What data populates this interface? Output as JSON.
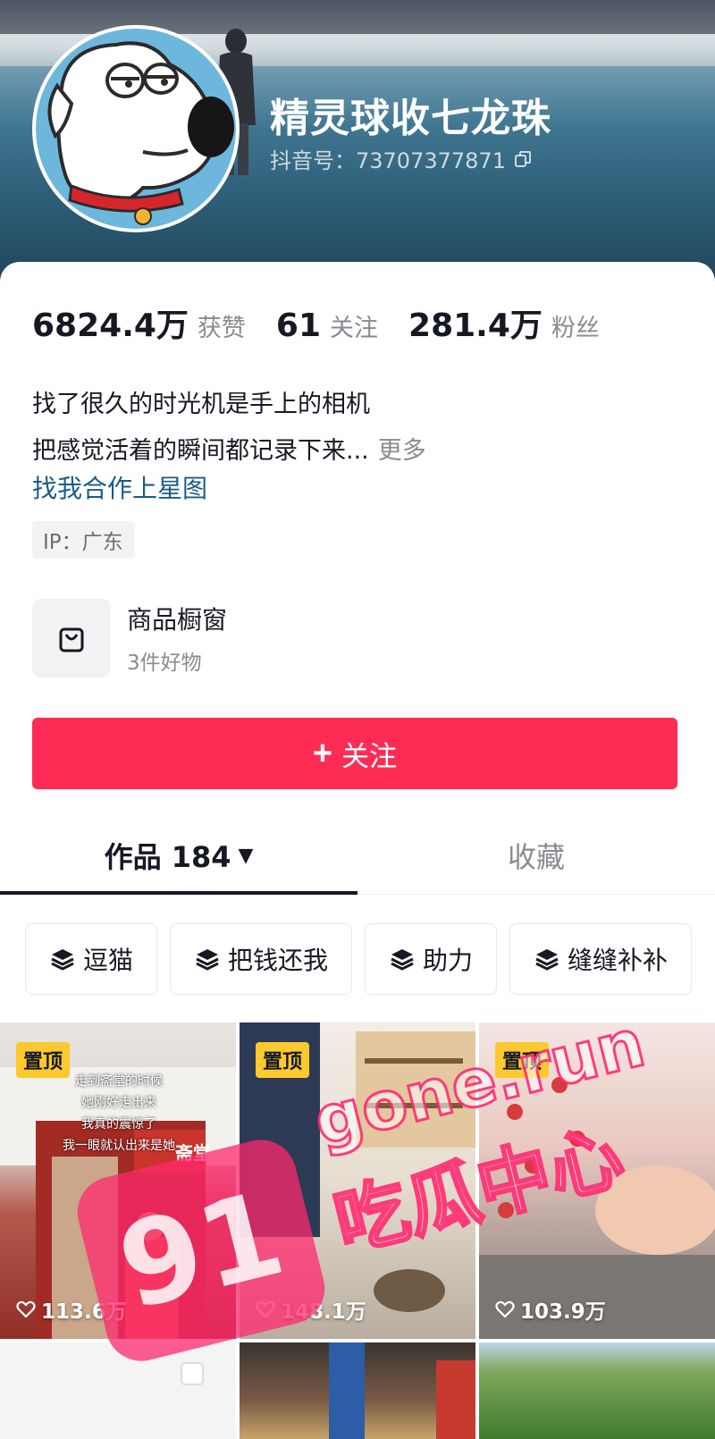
{
  "profile": {
    "nickname": "精灵球收七龙珠",
    "douyin_id": "抖音号：73707377871"
  },
  "stats": [
    {
      "value": "6824.4万",
      "label": "获赞"
    },
    {
      "value": "61",
      "label": "关注"
    },
    {
      "value": "281.4万",
      "label": "粉丝"
    }
  ],
  "bio": {
    "line1": "找了很久的时光机是手上的相机",
    "line2": "把感觉活着的瞬间都记录下来...",
    "more": "更多",
    "collab": "找我合作上星图",
    "ip": "IP：广东"
  },
  "shop": {
    "title": "商品橱窗",
    "subtitle": "3件好物",
    "icon": "shopping-bag-icon"
  },
  "follow": {
    "plus": "+",
    "label": "关注",
    "color": "#fe2c55"
  },
  "tabs": {
    "works": "作品 184",
    "favorites": "收藏"
  },
  "collections": [
    {
      "label": "逗猫"
    },
    {
      "label": "把钱还我"
    },
    {
      "label": "助力"
    },
    {
      "label": "缝缝补补"
    }
  ],
  "videos": [
    {
      "pinned": "置顶",
      "likes": "113.6万",
      "caption": [
        "走到斋堂的时候",
        "她刚好走出来",
        "我真的震惊了",
        "我一眼就认出来是她"
      ],
      "sign": "斋堂"
    },
    {
      "pinned": "置顶",
      "likes": "148.1万"
    },
    {
      "pinned": "置顶",
      "likes": "103.9万"
    }
  ],
  "watermark": {
    "badge": "91",
    "domain": "gone.run",
    "text": "吃瓜中心"
  }
}
